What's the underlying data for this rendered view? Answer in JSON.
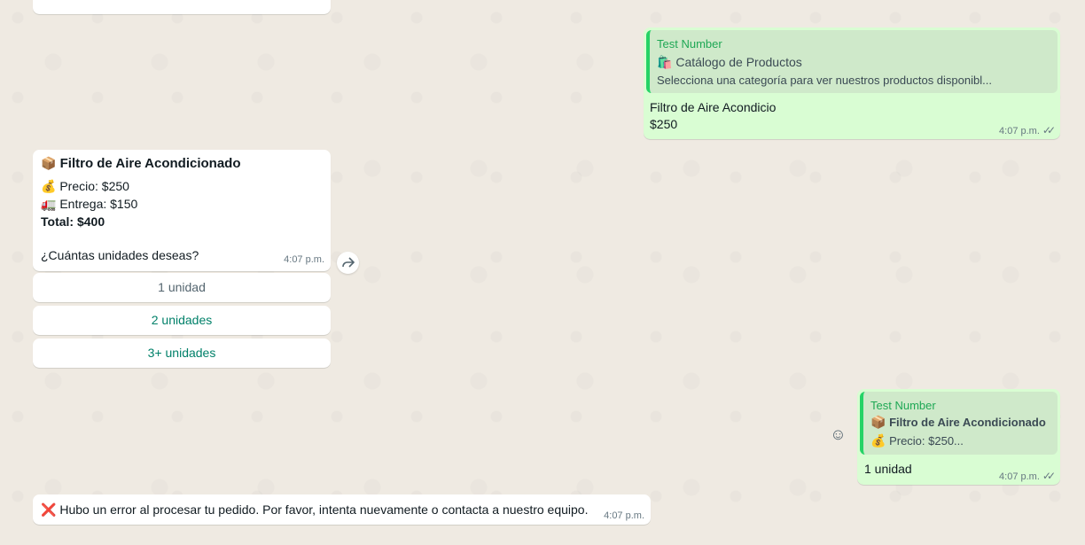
{
  "top_bubble": {},
  "catalog_reply": {
    "quote_author": "Test Number",
    "quote_title": "Catálogo de Productos",
    "quote_title_icon": "🛍️",
    "quote_text": "Selecciona una categoría para ver nuestros productos disponibl...",
    "line1": "Filtro de Aire Acondicio",
    "line2": "$250",
    "time": "4:07 p.m."
  },
  "product_message": {
    "title_icon": "📦",
    "title": "Filtro de Aire Acondicionado",
    "price_icon": "💰",
    "price": "Precio: $250",
    "delivery_icon": "🚛",
    "delivery": "Entrega: $150",
    "total": "Total: $400",
    "question": "¿Cuántas unidades deseas?",
    "time": "4:07 p.m."
  },
  "quick_replies": [
    {
      "label": "1 unidad"
    },
    {
      "label": "2 unidades"
    },
    {
      "label": "3+ unidades"
    }
  ],
  "unit_reply": {
    "quote_author": "Test Number",
    "quote_title_icon": "📦",
    "quote_title": "Filtro de Aire Acondicionado",
    "quote_price_icon": "💰",
    "quote_price": "Precio: $250...",
    "text": "1 unidad",
    "time": "4:07 p.m."
  },
  "error_message": {
    "icon": "❌",
    "text": "Hubo un error al procesar tu pedido. Por favor, intenta nuevamente o contacta a nuestro equipo.",
    "time": "4:07 p.m."
  },
  "icons": {
    "forward": "forward-icon",
    "emoji": "emoji-icon",
    "double_check": "double-check-icon"
  },
  "colors": {
    "background": "#efeae2",
    "outgoing": "#d9fdd3",
    "incoming": "#ffffff",
    "accent": "#008069",
    "quote_bar": "#25d366"
  }
}
